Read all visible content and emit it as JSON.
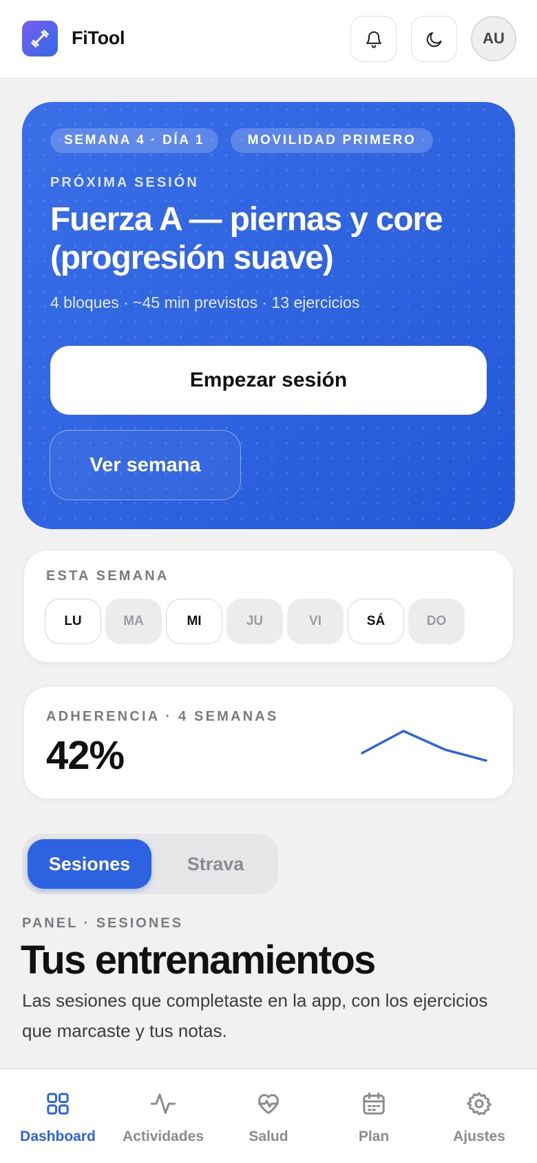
{
  "header": {
    "app_name": "FiTool",
    "avatar_initials": "AU",
    "icons": [
      "dumbbell-icon",
      "bell-icon",
      "moon-icon"
    ]
  },
  "hero": {
    "chip_week": "SEMANA 4 · DÍA 1",
    "chip_focus": "MOVILIDAD PRIMERO",
    "eyebrow": "PRÓXIMA SESIÓN",
    "title": "Fuerza A — piernas y core (progresión suave)",
    "meta": "4 bloques · ~45 min previstos · 13 ejercicios",
    "start_label": "Empezar sesión",
    "week_label": "Ver semana"
  },
  "this_week": {
    "label": "ESTA SEMANA",
    "days": [
      {
        "label": "LU",
        "active": true
      },
      {
        "label": "MA",
        "active": false
      },
      {
        "label": "MI",
        "active": true
      },
      {
        "label": "JU",
        "active": false
      },
      {
        "label": "VI",
        "active": false
      },
      {
        "label": "SÁ",
        "active": true
      },
      {
        "label": "DO",
        "active": false
      }
    ]
  },
  "adherence": {
    "label": "ADHERENCIA · 4 SEMANAS",
    "value": "42%",
    "sparkline": [
      25,
      75,
      33,
      8
    ]
  },
  "tabs": {
    "active": "Sesiones",
    "inactive": "Strava"
  },
  "section": {
    "eyebrow": "PANEL · SESIONES",
    "title": "Tus entrenamientos",
    "description": "Las sesiones que completaste en la app, con los ejercicios que marcaste y tus notas."
  },
  "bottom_nav": {
    "items": [
      {
        "label": "Dashboard",
        "icon": "grid-icon",
        "active": true
      },
      {
        "label": "Actividades",
        "icon": "activity-icon",
        "active": false
      },
      {
        "label": "Salud",
        "icon": "heart-pulse-icon",
        "active": false
      },
      {
        "label": "Plan",
        "icon": "calendar-icon",
        "active": false
      },
      {
        "label": "Ajustes",
        "icon": "gear-icon",
        "active": false
      }
    ]
  },
  "colors": {
    "accent": "#2d63e0",
    "background": "#f1f1f2",
    "muted": "#8b8b91"
  }
}
